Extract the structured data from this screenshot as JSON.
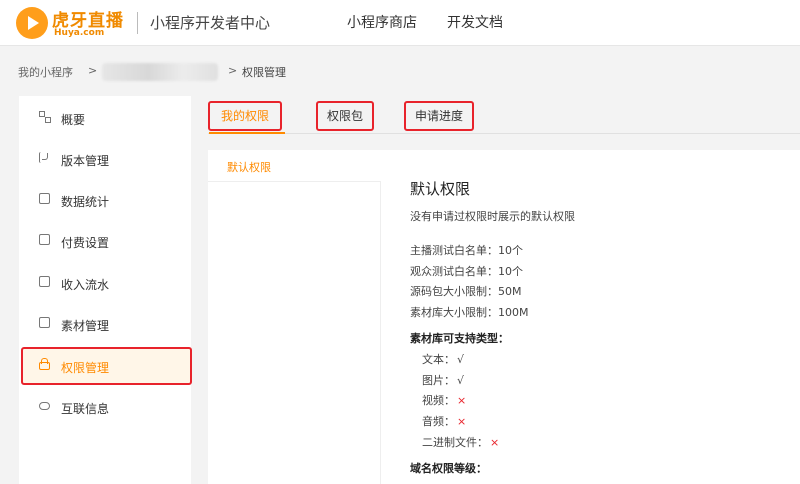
{
  "header": {
    "logo_cn": "虎牙直播",
    "logo_en": "Huya.com",
    "title": "小程序开发者中心",
    "nav": [
      "小程序商店",
      "开发文档"
    ]
  },
  "breadcrumb": {
    "root": "我的小程序",
    "sep": ">",
    "current": "权限管理"
  },
  "sidebar": {
    "items": [
      {
        "label": "概要",
        "icon": "grid-icon"
      },
      {
        "label": "版本管理",
        "icon": "branch-icon"
      },
      {
        "label": "数据统计",
        "icon": "chart-icon"
      },
      {
        "label": "付费设置",
        "icon": "payment-icon"
      },
      {
        "label": "收入流水",
        "icon": "income-icon"
      },
      {
        "label": "素材管理",
        "icon": "folder-icon"
      },
      {
        "label": "权限管理",
        "icon": "lock-icon",
        "active": true
      },
      {
        "label": "互联信息",
        "icon": "cloud-icon"
      }
    ]
  },
  "tabs": [
    "我的权限",
    "权限包",
    "申请进度"
  ],
  "panel": {
    "left_label": "默认权限",
    "title": "默认权限",
    "desc": "没有申请过权限时展示的默认权限",
    "limits": [
      "主播测试白名单：10个",
      "观众测试白名单：10个",
      "源码包大小限制：50M",
      "素材库大小限制：100M"
    ],
    "types_head": "素材库可支持类型：",
    "types": [
      {
        "label": "文本：",
        "mark": "√",
        "ok": true
      },
      {
        "label": "图片：",
        "mark": "√",
        "ok": true
      },
      {
        "label": "视频：",
        "mark": "×",
        "ok": false
      },
      {
        "label": "音频：",
        "mark": "×",
        "ok": false
      },
      {
        "label": "二进制文件：",
        "mark": "×",
        "ok": false
      }
    ],
    "domain_head": "域名权限等级："
  },
  "colors": {
    "accent": "#ff8a00",
    "highlight_outline": "#e8232b",
    "active_bg": "#fff6e8"
  }
}
